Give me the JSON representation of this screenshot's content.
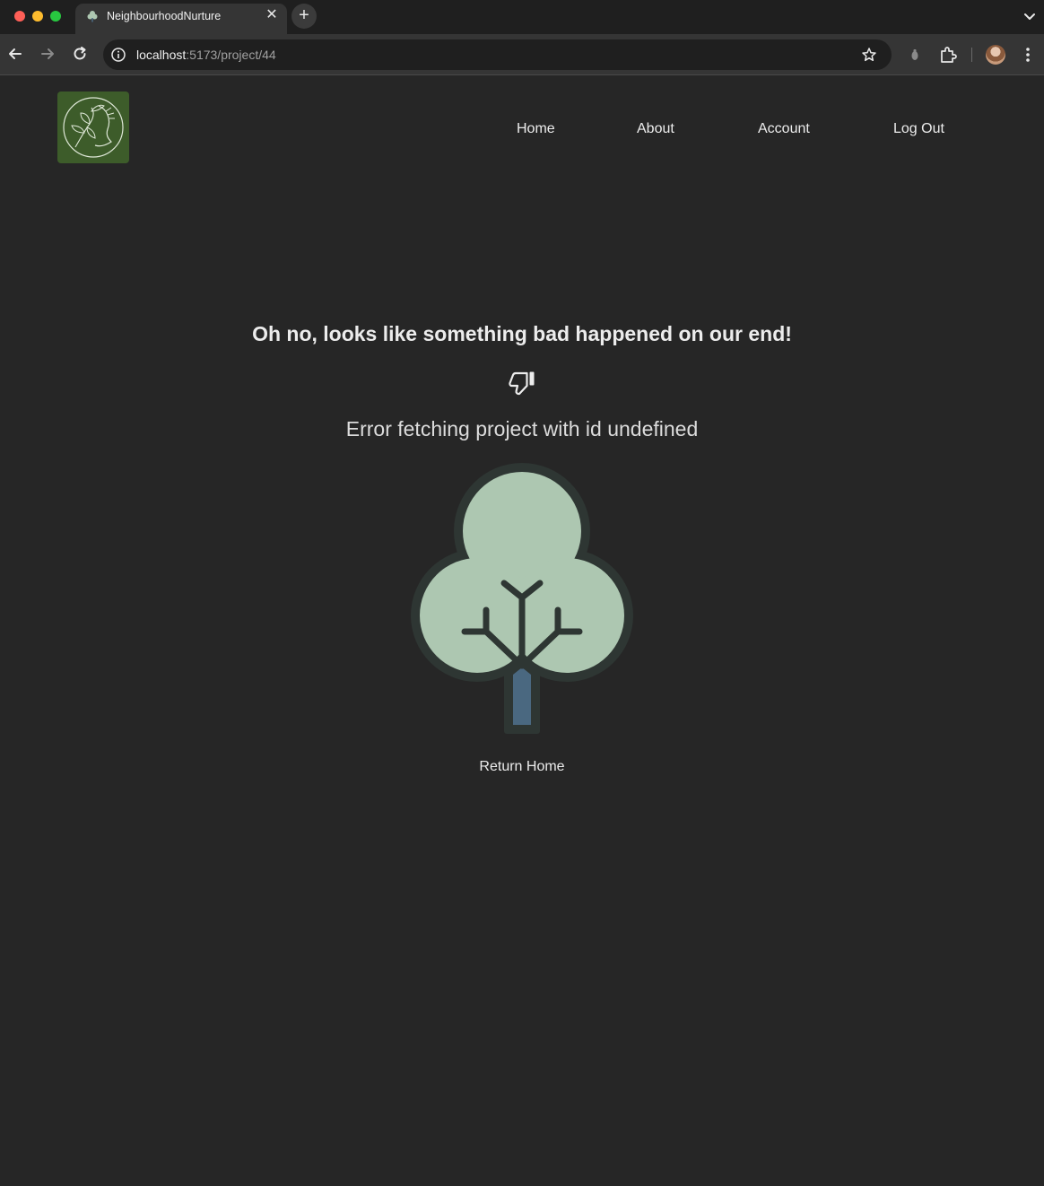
{
  "browser": {
    "tab": {
      "title": "NeighbourhoodNurture"
    },
    "url": {
      "host": "localhost",
      "path": ":5173/project/44"
    }
  },
  "nav": {
    "links": [
      "Home",
      "About",
      "Account",
      "Log Out"
    ]
  },
  "error": {
    "title": "Oh no, looks like something bad happened on our end!",
    "message": "Error fetching project with id undefined",
    "return_label": "Return Home"
  },
  "icons": {
    "thumb": "thumbs-down-icon",
    "tree": "tree-illustration",
    "logo": "floral-portrait-logo"
  },
  "colors": {
    "page_bg": "#262626",
    "logo_bg": "#3d5c2a",
    "tree_canopy": "#adc7b1",
    "tree_outline": "#2e3633",
    "tree_trunk": "#4a6880"
  }
}
